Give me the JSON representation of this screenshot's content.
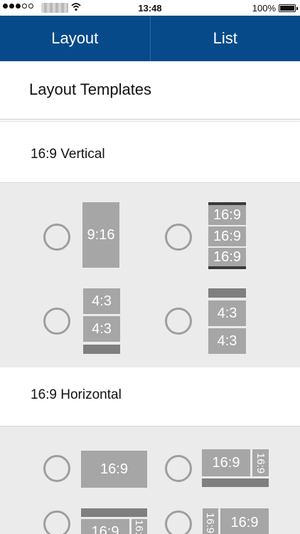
{
  "status": {
    "time": "13:48",
    "battery": "100%"
  },
  "tabs": [
    {
      "label": "Layout"
    },
    {
      "label": "List"
    }
  ],
  "page": {
    "title": "Layout Templates"
  },
  "sections": [
    {
      "label": "16:9 Vertical"
    },
    {
      "label": "16:9 Horizontal"
    }
  ],
  "tiles": {
    "r9_16": "9:16",
    "r16_9": "16:9",
    "r4_3": "4:3"
  },
  "colors": {
    "header": "#074a8a",
    "tile": "#a6a6a6",
    "panel": "#ebebeb"
  }
}
